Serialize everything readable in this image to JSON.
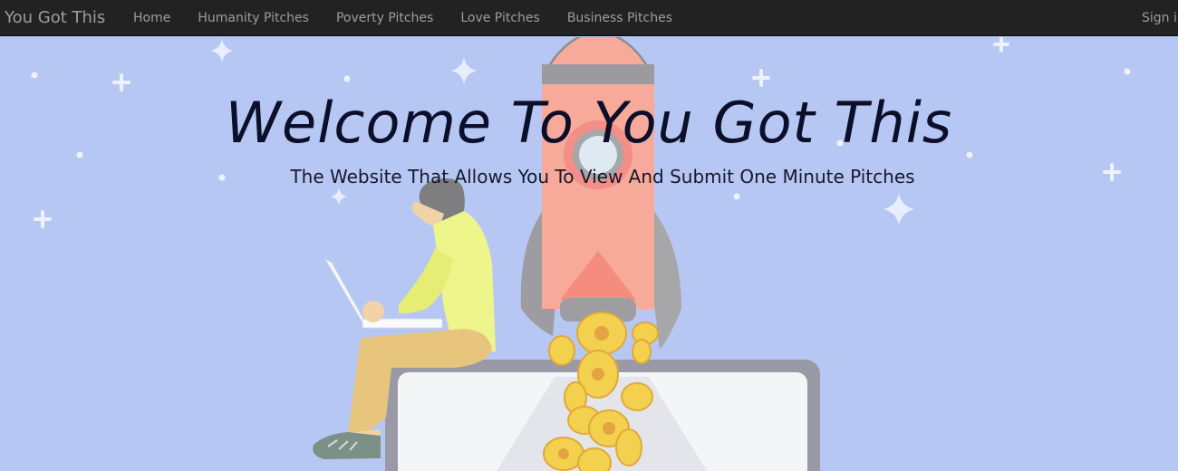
{
  "navbar": {
    "brand": "You Got This",
    "links": [
      "Home",
      "Humanity Pitches",
      "Poverty Pitches",
      "Love Pitches",
      "Business Pitches"
    ],
    "signin": "Sign i"
  },
  "hero": {
    "title": "Welcome To You Got This",
    "subtitle": "The Website That Allows You To View And Submit One Minute Pitches"
  },
  "colors": {
    "navbar_bg": "#222222",
    "nav_text": "#9d9d9d",
    "hero_bg": "#b7c7f4",
    "rocket_body": "#f7a99a",
    "rocket_fin": "#9a9a9e",
    "shirt": "#eef58b",
    "pants": "#e8c57d",
    "coin": "#f3d04d"
  },
  "icons": [
    "sparkle-icon",
    "rocket-illustration",
    "coin-icon",
    "person-with-laptop-illustration"
  ]
}
